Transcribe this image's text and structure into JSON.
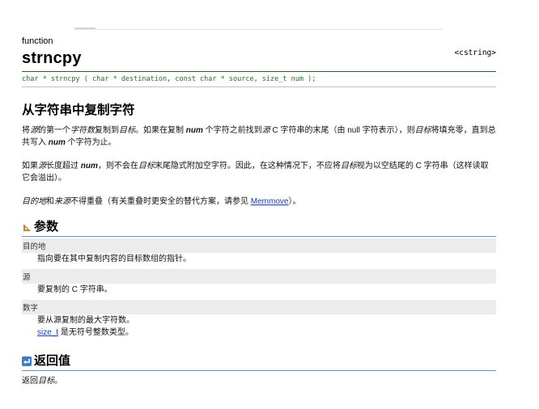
{
  "header": {
    "type_label": "function",
    "title": "strncpy",
    "header_tag": "<cstring>",
    "prototype": "char * strncpy ( char * destination, const char * source, size_t num );"
  },
  "description": {
    "title": "从字符串中复制字符",
    "p1": {
      "a": "将",
      "b": "源",
      "c": "的第一个",
      "d": "字符数",
      "e": "复制到",
      "f": "目标",
      "g": "。如果在复制 ",
      "h": "num",
      "i": " 个字符之前找到",
      "j": "源",
      "k": " C 字符串的末尾（由 null 字符表示），则",
      "l": "目标",
      "m": "将填充零，直到总共写入 ",
      "n": "num",
      "o": " 个字符为止。"
    },
    "p2": {
      "a": "如果",
      "b": "源",
      "c": "长度超过 ",
      "d": "num",
      "e": "，则不会在",
      "f": "目标",
      "g": "末尾隐式附加空字符。因此，在这种情况下，不应将",
      "h": "目标",
      "i": "视为以空结尾的 C 字符串（这样读取它会溢出）。"
    },
    "p3": {
      "a": "目的地",
      "b": "和",
      "c": "来源",
      "d": "不得重叠（有关重叠时更安全的替代方案，请参见 ",
      "e": "Memmove",
      "f": "）。"
    }
  },
  "parameters": {
    "title": "参数",
    "items": [
      {
        "name": "目的地",
        "desc": "指向要在其中复制内容的目标数组的指针。"
      },
      {
        "name": "源",
        "desc": "要复制的 C 字符串。"
      },
      {
        "name": "数字",
        "desc1": "要从源复制的最大字符数。",
        "desc2_link": "size_t",
        "desc2_rest": " 是无符号整数类型。"
      }
    ]
  },
  "return_value": {
    "title": "返回值",
    "text_a": "返回",
    "text_b": "目标",
    "text_c": "。"
  },
  "colors": {
    "prototype_text": "#2a6b2a",
    "link": "#1a3fa8",
    "param_bg": "#ececec",
    "section_rule": "#6b8fb5"
  },
  "icons": {
    "parameters": "ruler-triangle-icon",
    "return_value": "return-arrow-icon"
  }
}
